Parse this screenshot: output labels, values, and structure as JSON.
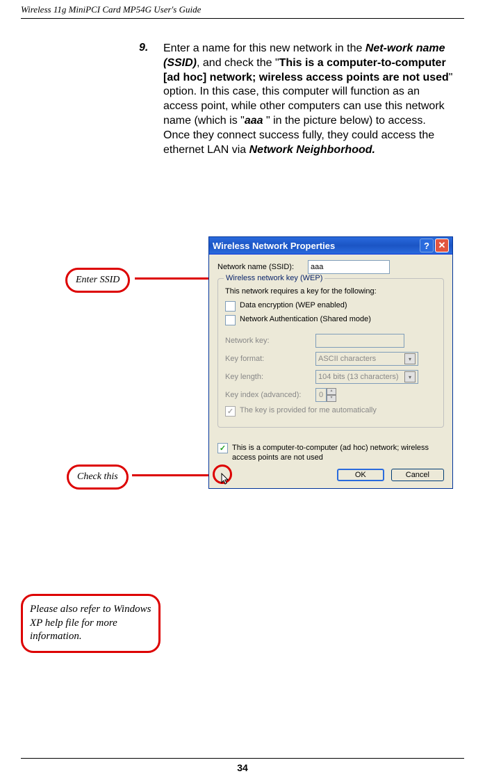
{
  "header": {
    "title": "Wireless 11g MiniPCI Card MP54G User's Guide"
  },
  "step": {
    "number": "9.",
    "part1": "Enter a name for this new network in the ",
    "netname": "Net-work name (SSID)",
    "part2": ",  and check the \"",
    "option": "This is a computer-to-computer [ad hoc] network; wireless access points are not used",
    "part3": "\" option.  In this case, this computer will function as an access point, while other computers can use this network name (which is \"",
    "aaa": "aaa ",
    "part4": "\" in the picture below) to access.  Once they connect success fully, they could access the ethernet LAN via ",
    "neighborhood": "Network Neighborhood."
  },
  "callouts": {
    "enterSsid": "Enter SSID",
    "checkThis": "Check this",
    "note": "Please also refer to Windows XP help file for more information."
  },
  "dialog": {
    "title": "Wireless Network Properties",
    "ssidLabel": "Network name (SSID):",
    "ssidValue": "aaa",
    "wepLegend": "Wireless network key (WEP)",
    "wepDesc": "This network requires a key for the following:",
    "dataEnc": "Data encryption (WEP enabled)",
    "netAuth": "Network Authentication (Shared mode)",
    "netKey": "Network key:",
    "keyFormat": "Key format:",
    "keyFormatVal": "ASCII characters",
    "keyLength": "Key length:",
    "keyLengthVal": "104 bits (13 characters)",
    "keyIndex": "Key index (advanced):",
    "keyIndexVal": "0",
    "autoKey": "The key is provided for me automatically",
    "adhoc": "This is a computer-to-computer (ad hoc) network; wireless access points are not used",
    "ok": "OK",
    "cancel": "Cancel"
  },
  "pageNumber": "34"
}
